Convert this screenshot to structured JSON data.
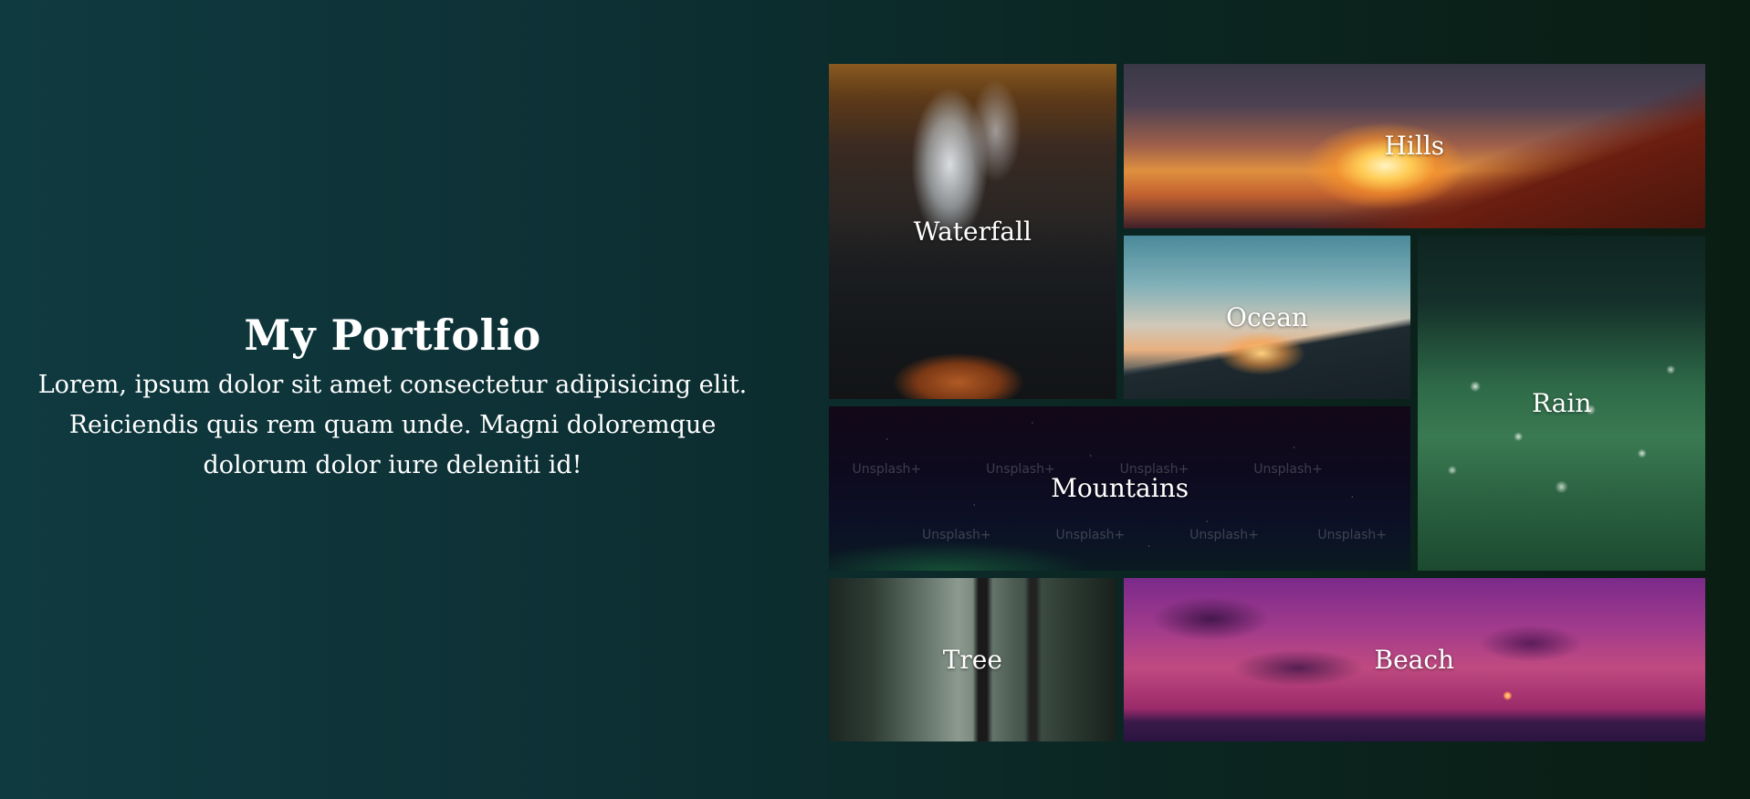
{
  "intro": {
    "title": "My Portfolio",
    "description": "Lorem, ipsum dolor sit amet consectetur adipisicing elit. Reiciendis quis rem quam unde. Magni doloremque dolorum dolor iure deleniti id!"
  },
  "gallery": {
    "tiles": [
      {
        "label": "Waterfall"
      },
      {
        "label": "Hills"
      },
      {
        "label": "Ocean"
      },
      {
        "label": "Rain"
      },
      {
        "label": "Mountains"
      },
      {
        "label": "Tree"
      },
      {
        "label": "Beach"
      }
    ],
    "watermark": "Unsplash+"
  },
  "colors": {
    "background_start": "#0f3a40",
    "background_end": "#0a1d12",
    "text": "#ffffff"
  }
}
